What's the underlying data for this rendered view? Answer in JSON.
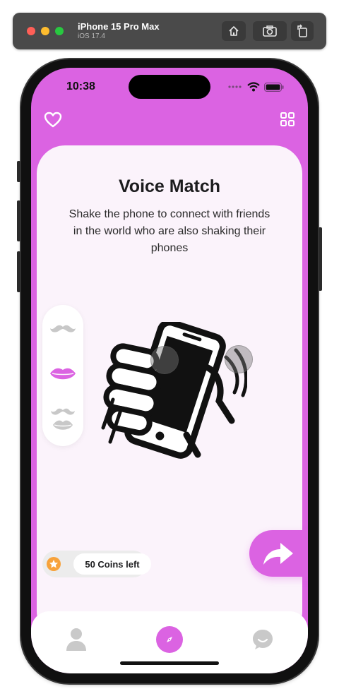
{
  "simulator": {
    "device_name": "iPhone 15 Pro Max",
    "os_version": "iOS 17.4"
  },
  "status_bar": {
    "time": "10:38"
  },
  "header": {
    "title": "Voice Match",
    "description": "Shake the phone to connect with friends in the world who are also shaking their phones"
  },
  "emoji_selector": {
    "items": [
      "mustache-icon",
      "lips-icon",
      "mustache-lips-icon"
    ],
    "selected_index": 1
  },
  "coins": {
    "label": "50 Coins left"
  },
  "tabbar": {
    "items": [
      "profile-icon",
      "compass-icon",
      "chat-icon"
    ],
    "active_index": 1
  },
  "colors": {
    "accent": "#db63e2",
    "card_background": "#fbf3fb",
    "coin": "#f7a23b"
  }
}
